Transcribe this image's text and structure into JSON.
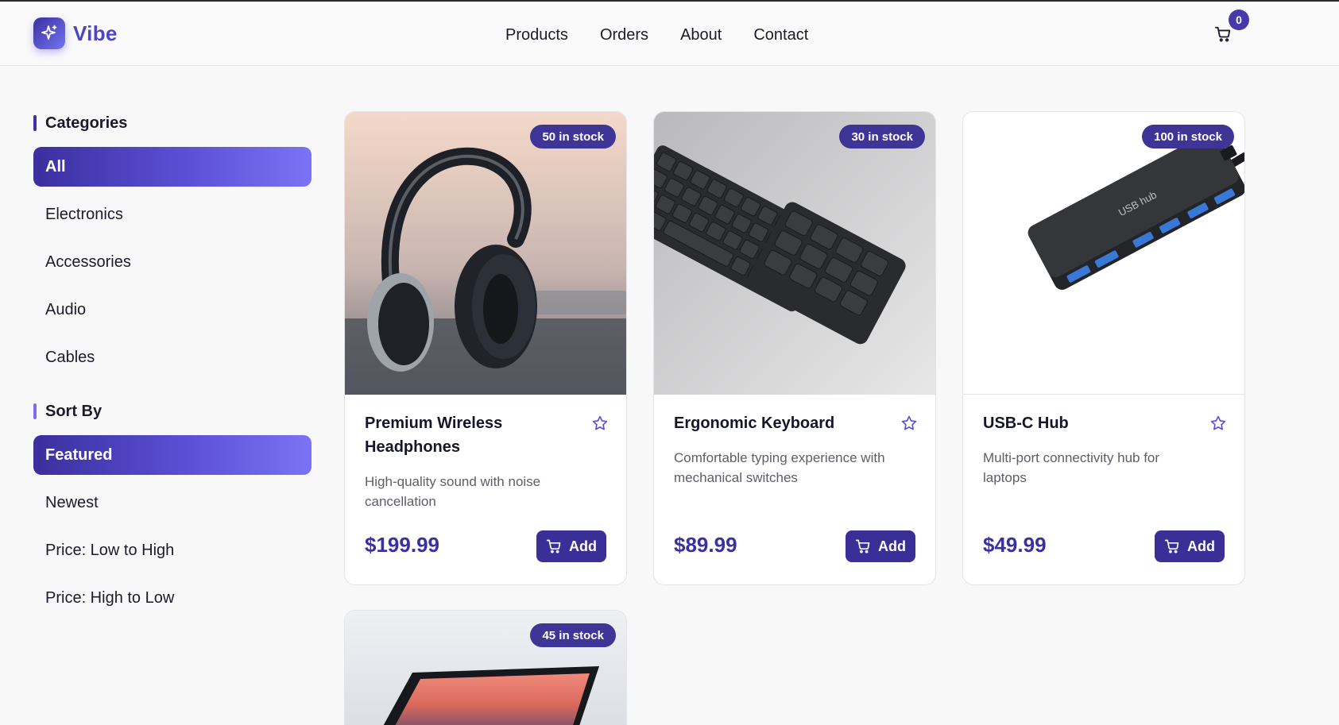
{
  "brand": {
    "name": "Vibe"
  },
  "nav": {
    "items": [
      "Products",
      "Orders",
      "About",
      "Contact"
    ]
  },
  "cart": {
    "count": "0"
  },
  "sidebar": {
    "categories_title": "Categories",
    "categories": [
      "All",
      "Electronics",
      "Accessories",
      "Audio",
      "Cables"
    ],
    "active_category": "All",
    "sort_title": "Sort By",
    "sort_options": [
      "Featured",
      "Newest",
      "Price: Low to High",
      "Price: High to Low"
    ],
    "active_sort": "Featured"
  },
  "products": [
    {
      "name": "Premium Wireless Headphones",
      "description": "High-quality sound with noise cancellation",
      "price": "$199.99",
      "stock": "50 in stock",
      "add_label": "Add",
      "image": "headphones"
    },
    {
      "name": "Ergonomic Keyboard",
      "description": "Comfortable typing experience with mechanical switches",
      "price": "$89.99",
      "stock": "30 in stock",
      "add_label": "Add",
      "image": "keyboard"
    },
    {
      "name": "USB-C Hub",
      "description": "Multi-port connectivity hub for laptops",
      "price": "$49.99",
      "stock": "100 in stock",
      "add_label": "Add",
      "image": "usb-hub",
      "image_label": "USB hub"
    },
    {
      "name": "",
      "description": "",
      "price": "",
      "stock": "45 in stock",
      "add_label": "",
      "image": "laptop"
    }
  ],
  "colors": {
    "accent": "#453aa8",
    "accent_light": "#7a74f5",
    "price": "#3a31a0"
  }
}
